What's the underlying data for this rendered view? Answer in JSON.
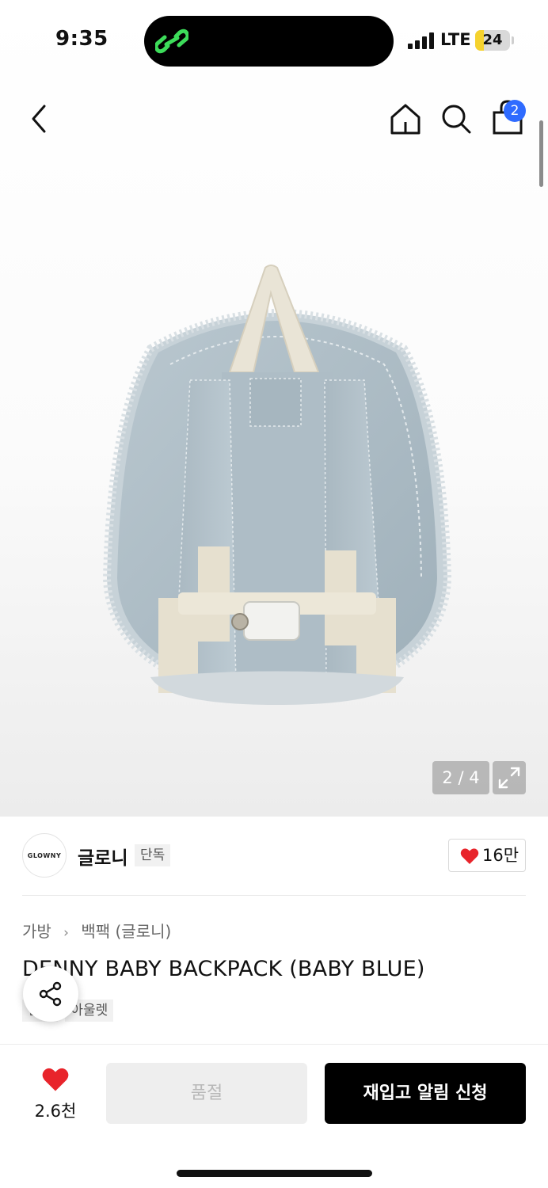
{
  "status_bar": {
    "time": "9:35",
    "carrier": "LTE",
    "battery": "24",
    "battery_level": 0.24,
    "colors": {
      "island_icon": "#3ddc5a",
      "battery": "#f5d22e"
    }
  },
  "header": {
    "icons": [
      "chevron-left-icon",
      "home-icon",
      "search-icon",
      "shopping-bag-icon"
    ],
    "cart_count": "2",
    "colors": {
      "badge": "#2f6bff"
    }
  },
  "gallery": {
    "page_indicator": "2 / 4",
    "current_page": 2,
    "total_pages": 4,
    "icons": [
      "expand-icon"
    ]
  },
  "brand": {
    "logo_text": "GLOWNY",
    "name": "글로니",
    "tag": "단독",
    "like_count": "16만",
    "colors": {
      "heart": "#e8242b"
    }
  },
  "product": {
    "breadcrumb": [
      "가방",
      "백팩 (글로니)"
    ],
    "title": "DENNY BABY BACKPACK (BABY BLUE)",
    "tags": [
      "단독",
      "아울렛"
    ]
  },
  "bottom_bar": {
    "like_count": "2.6천",
    "soldout_label": "품절",
    "restock_label": "재입고 알림 신청",
    "colors": {
      "primary": "#000000",
      "disabled": "#eeeeee"
    }
  }
}
